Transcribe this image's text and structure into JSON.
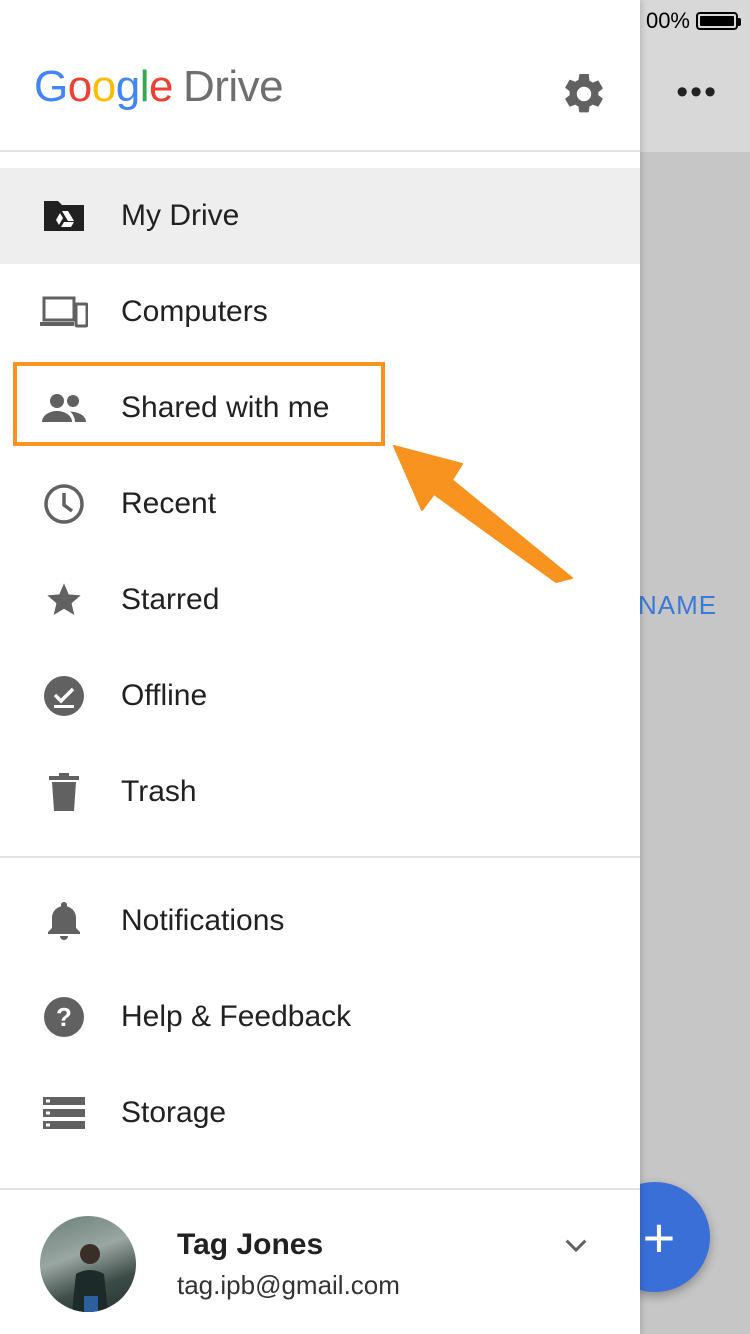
{
  "status": {
    "battery_text": "00%"
  },
  "background": {
    "sort_label": "NAME",
    "fab_symbol": "+"
  },
  "header": {
    "logo_google": [
      "G",
      "o",
      "o",
      "g",
      "l",
      "e"
    ],
    "logo_drive": "Drive"
  },
  "nav": {
    "items": [
      {
        "label": "My Drive",
        "icon": "my-drive-icon",
        "active": true
      },
      {
        "label": "Computers",
        "icon": "computers-icon"
      },
      {
        "label": "Shared with me",
        "icon": "people-icon"
      },
      {
        "label": "Recent",
        "icon": "clock-icon"
      },
      {
        "label": "Starred",
        "icon": "star-icon"
      },
      {
        "label": "Offline",
        "icon": "offline-icon"
      },
      {
        "label": "Trash",
        "icon": "trash-icon"
      }
    ],
    "secondary": [
      {
        "label": "Notifications",
        "icon": "bell-icon"
      },
      {
        "label": "Help & Feedback",
        "icon": "help-icon"
      },
      {
        "label": "Storage",
        "icon": "storage-icon"
      }
    ]
  },
  "account": {
    "name": "Tag Jones",
    "email": "tag.ipb@gmail.com"
  },
  "colors": {
    "accent": "#3a6fd8",
    "highlight": "#f7931e",
    "icon": "#616161"
  }
}
